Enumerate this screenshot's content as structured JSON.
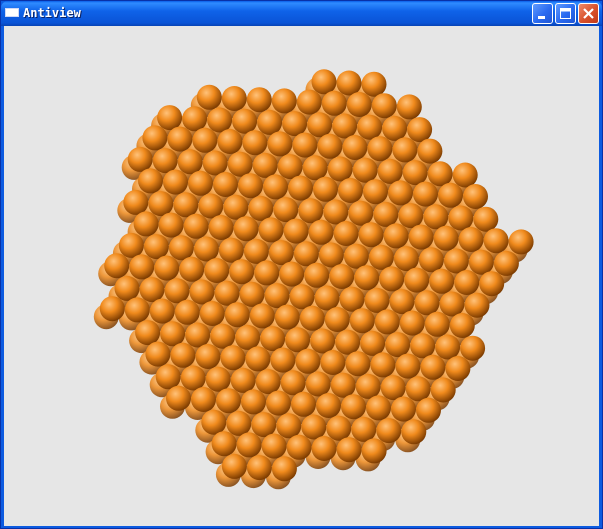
{
  "window": {
    "title": "Antiview",
    "buttons": {
      "minimize": "minimize",
      "maximize": "maximize",
      "close": "close"
    }
  },
  "viewport": {
    "background_color": "#e6e6e6",
    "sphere_color": "#f08a1c",
    "sphere_highlight": "#ffc27a",
    "sphere_shadow": "#7a3a00",
    "shape": "icosahedral-nanoparticle"
  }
}
